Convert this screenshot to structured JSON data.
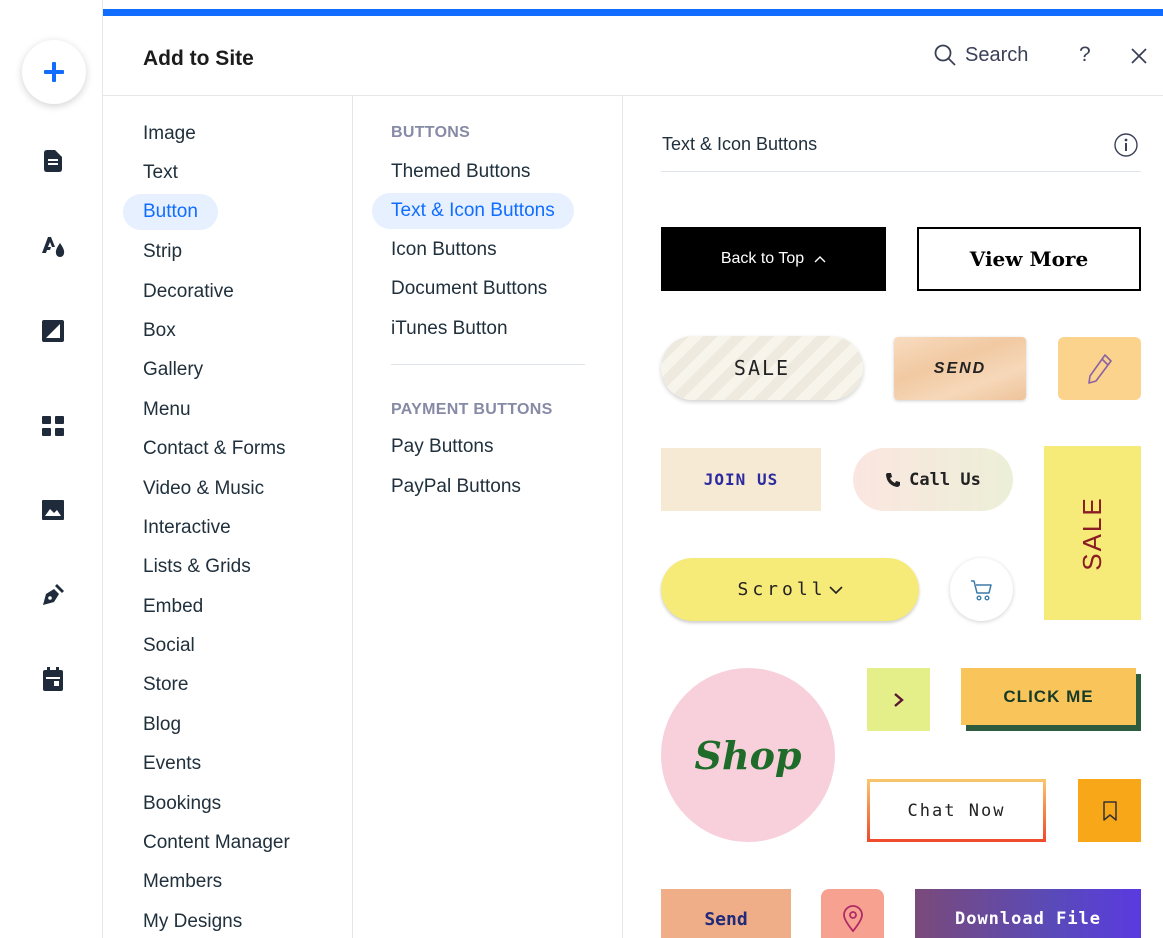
{
  "panel": {
    "title": "Add to Site",
    "search_label": "Search",
    "help_label": "?"
  },
  "categories": [
    "Image",
    "Text",
    "Button",
    "Strip",
    "Decorative",
    "Box",
    "Gallery",
    "Menu",
    "Contact & Forms",
    "Video & Music",
    "Interactive",
    "Lists & Grids",
    "Embed",
    "Social",
    "Store",
    "Blog",
    "Events",
    "Bookings",
    "Content Manager",
    "Members",
    "My Designs"
  ],
  "selected_category": "Button",
  "subcategories": {
    "buttons_heading": "BUTTONS",
    "buttons": [
      "Themed Buttons",
      "Text & Icon Buttons",
      "Icon Buttons",
      "Document Buttons",
      "iTunes Button"
    ],
    "payment_heading": "PAYMENT BUTTONS",
    "payment": [
      "Pay Buttons",
      "PayPal Buttons"
    ]
  },
  "selected_subcategory": "Text & Icon Buttons",
  "preview": {
    "section_title": "Text & Icon Buttons",
    "buttons": {
      "back_to_top": "Back to Top",
      "view_more": "View More",
      "sale": "SALE",
      "send": "SEND",
      "join_us": "JOIN US",
      "call_us": "Call Us",
      "sale_vertical": "SALE",
      "scroll": "Scroll",
      "shop": "Shop",
      "click_me": "CLICK ME",
      "chat_now": "Chat Now",
      "send_small": "Send",
      "download_file": "Download File"
    }
  },
  "colors": {
    "accent": "#116dff",
    "selected_bg": "#e7f0ff"
  }
}
